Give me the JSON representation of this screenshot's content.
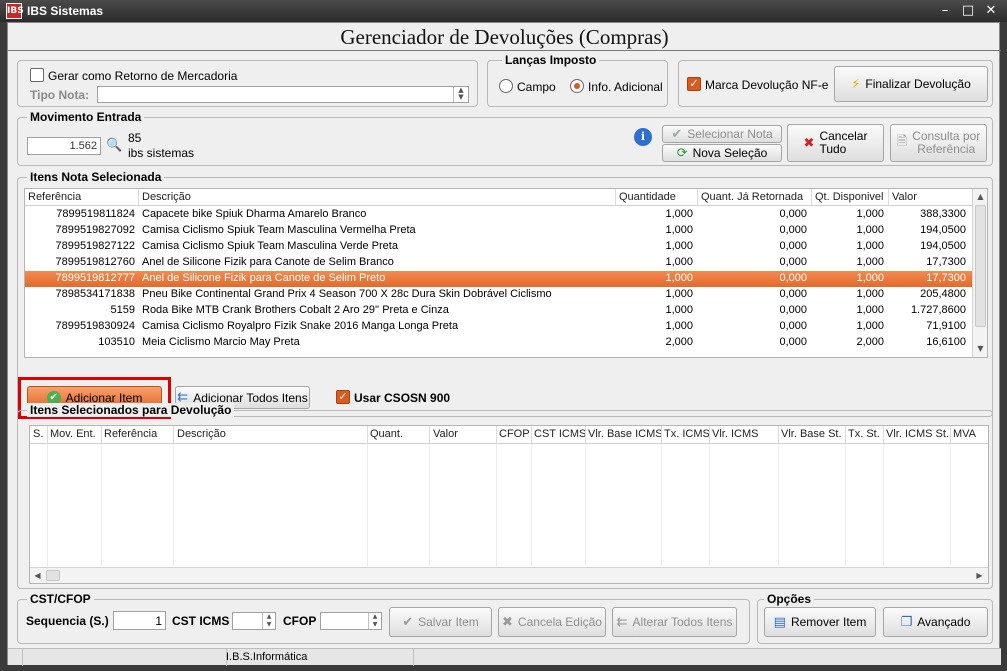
{
  "window": {
    "title": "IBS Sistemas",
    "icon_text": "IBS",
    "minimize": "–",
    "maximize": "□",
    "close": "✕"
  },
  "heading": "Gerenciador de Devoluções (Compras)",
  "retorno": {
    "checkbox_label": "Gerar como Retorno de Mercadoria",
    "tipo_nota_label": "Tipo Nota:",
    "tipo_nota_value": ""
  },
  "lancas": {
    "legend": "Lanças Imposto",
    "option_campo": "Campo",
    "option_info": "Info. Adicional",
    "selected": "Info. Adicional"
  },
  "marca": {
    "label": "Marca Devolução NF-e",
    "checked": true
  },
  "finalizar": {
    "label": "Finalizar Devolução"
  },
  "movimento": {
    "legend": "Movimento Entrada",
    "value": "1.562",
    "number": "85",
    "name": "ibs sistemas",
    "selecionar_nota": "Selecionar Nota",
    "nova_selecao": "Nova Seleção",
    "cancelar_tudo_line1": "Cancelar",
    "cancelar_tudo_line2": "Tudo",
    "consulta_line1": "Consulta por",
    "consulta_line2": "Referência"
  },
  "itens_nota": {
    "legend": "Itens Nota Selecionada",
    "columns": [
      "Referência",
      "Descrição",
      "Quantidade",
      "Quant. Já Retornada",
      "Qt. Disponivel",
      "Valor"
    ],
    "rows": [
      {
        "ref": "7899519811824",
        "desc": "Capacete bike Spiuk Dharma Amarelo Branco",
        "qtd": "1,000",
        "ret": "0,000",
        "disp": "1,000",
        "valor": "388,3300"
      },
      {
        "ref": "7899519827092",
        "desc": "Camisa Ciclismo Spiuk Team Masculina Vermelha Preta",
        "qtd": "1,000",
        "ret": "0,000",
        "disp": "1,000",
        "valor": "194,0500"
      },
      {
        "ref": "7899519827122",
        "desc": "Camisa Ciclismo Spiuk Team Masculina Verde Preta",
        "qtd": "1,000",
        "ret": "0,000",
        "disp": "1,000",
        "valor": "194,0500"
      },
      {
        "ref": "7899519812760",
        "desc": "Anel de Silicone Fizik para Canote de Selim Branco",
        "qtd": "1,000",
        "ret": "0,000",
        "disp": "1,000",
        "valor": "17,7300"
      },
      {
        "ref": "7899519812777",
        "desc": "Anel de Silicone Fizik para Canote de Selim Preto",
        "qtd": "1,000",
        "ret": "0,000",
        "disp": "1,000",
        "valor": "17,7300"
      },
      {
        "ref": "7898534171838",
        "desc": "Pneu Bike Continental Grand Prix 4 Season 700 X 28c Dura Skin Dobrável Ciclismo",
        "qtd": "1,000",
        "ret": "0,000",
        "disp": "1,000",
        "valor": "205,4800"
      },
      {
        "ref": "5159",
        "desc": "Roda Bike MTB Crank Brothers Cobalt 2 Aro 29'' Preta e Cinza",
        "qtd": "1,000",
        "ret": "0,000",
        "disp": "1,000",
        "valor": "1.727,8600"
      },
      {
        "ref": "7899519830924",
        "desc": "Camisa Ciclismo Royalpro Fizik Snake 2016 Manga Longa Preta",
        "qtd": "1,000",
        "ret": "0,000",
        "disp": "1,000",
        "valor": "71,9100"
      },
      {
        "ref": "103510",
        "desc": "Meia Ciclismo Marcio May Preta",
        "qtd": "2,000",
        "ret": "0,000",
        "disp": "2,000",
        "valor": "16,6100"
      }
    ],
    "selected_index": 4,
    "adicionar_item": "Adicionar Item",
    "adicionar_todos": "Adicionar Todos Itens",
    "usar_csosn": "Usar CSOSN 900"
  },
  "itens_devolucao": {
    "legend": "Itens Selecionados para Devolução",
    "columns": [
      "S.",
      "Mov. Ent.",
      "Referência",
      "Descrição",
      "Quant.",
      "Valor",
      "CFOP",
      "CST ICMS",
      "Vlr. Base ICMS",
      "Tx. ICMS",
      "Vlr. ICMS",
      "Vlr. Base St.",
      "Tx. St.",
      "Vlr. ICMS St.",
      "MVA"
    ]
  },
  "cst_cfop": {
    "legend": "CST/CFOP",
    "sequencia_label": "Sequencia (S.)",
    "sequencia_value": "1",
    "cst_icms_label": "CST ICMS",
    "cfop_label": "CFOP",
    "salvar_item": "Salvar Item",
    "cancela_edicao": "Cancela Edição",
    "alterar_todos": "Alterar Todos Itens"
  },
  "opcoes": {
    "legend": "Opções",
    "remover_item": "Remover Item",
    "avancado": "Avançado"
  },
  "status": {
    "company": "I.B.S.Informática"
  },
  "colors": {
    "accent": "#e46a2a",
    "highlight_box": "#e00000"
  }
}
